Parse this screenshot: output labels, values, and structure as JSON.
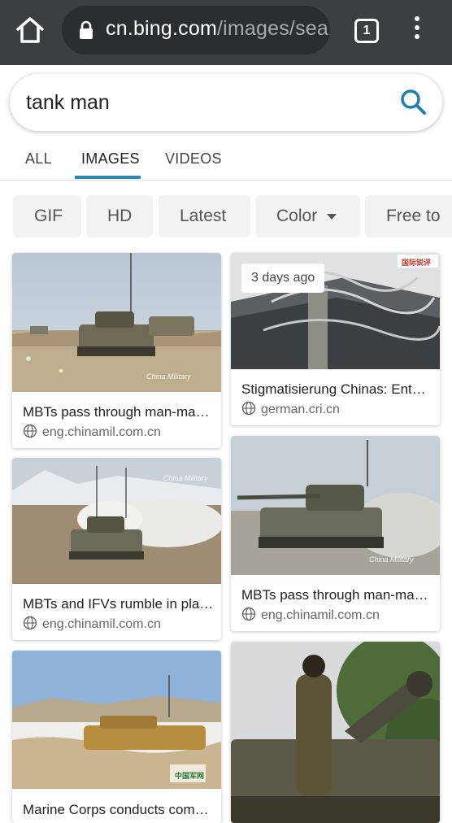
{
  "browser": {
    "url_domain": "cn.bing.com",
    "url_path": "/images/sea",
    "tab_count": "1"
  },
  "search": {
    "query": "tank man"
  },
  "nav": {
    "tabs": [
      {
        "label": "ALL"
      },
      {
        "label": "IMAGES"
      },
      {
        "label": "VIDEOS"
      }
    ],
    "active": "IMAGES"
  },
  "filters": {
    "chips": [
      {
        "label": "GIF"
      },
      {
        "label": "HD"
      },
      {
        "label": "Latest"
      },
      {
        "label": "Color"
      },
      {
        "label": "Free to"
      }
    ]
  },
  "results": {
    "col1": [
      {
        "title": "MBTs pass through man-made…",
        "source": "eng.chinamil.com.cn",
        "watermark": "China Military"
      },
      {
        "title": "MBTs and IFVs rumble in pla…",
        "source": "eng.chinamil.com.cn",
        "watermark": "China Military"
      },
      {
        "title": "Marine Corps conducts com…",
        "watermark": "中国军网"
      }
    ],
    "col2": [
      {
        "badge": "3 days ago",
        "title": "Stigmatisierung Chinas: Ente…",
        "source": "german.cri.cn",
        "watermark": "国际锐评"
      },
      {
        "title": "MBTs pass through man-made…",
        "source": "eng.chinamil.com.cn",
        "watermark": "China Military"
      },
      {}
    ]
  },
  "colors": {
    "browser_bar": "#3c3f42",
    "accent": "#2a8bb8",
    "chip_bg": "#f2f2f2"
  }
}
